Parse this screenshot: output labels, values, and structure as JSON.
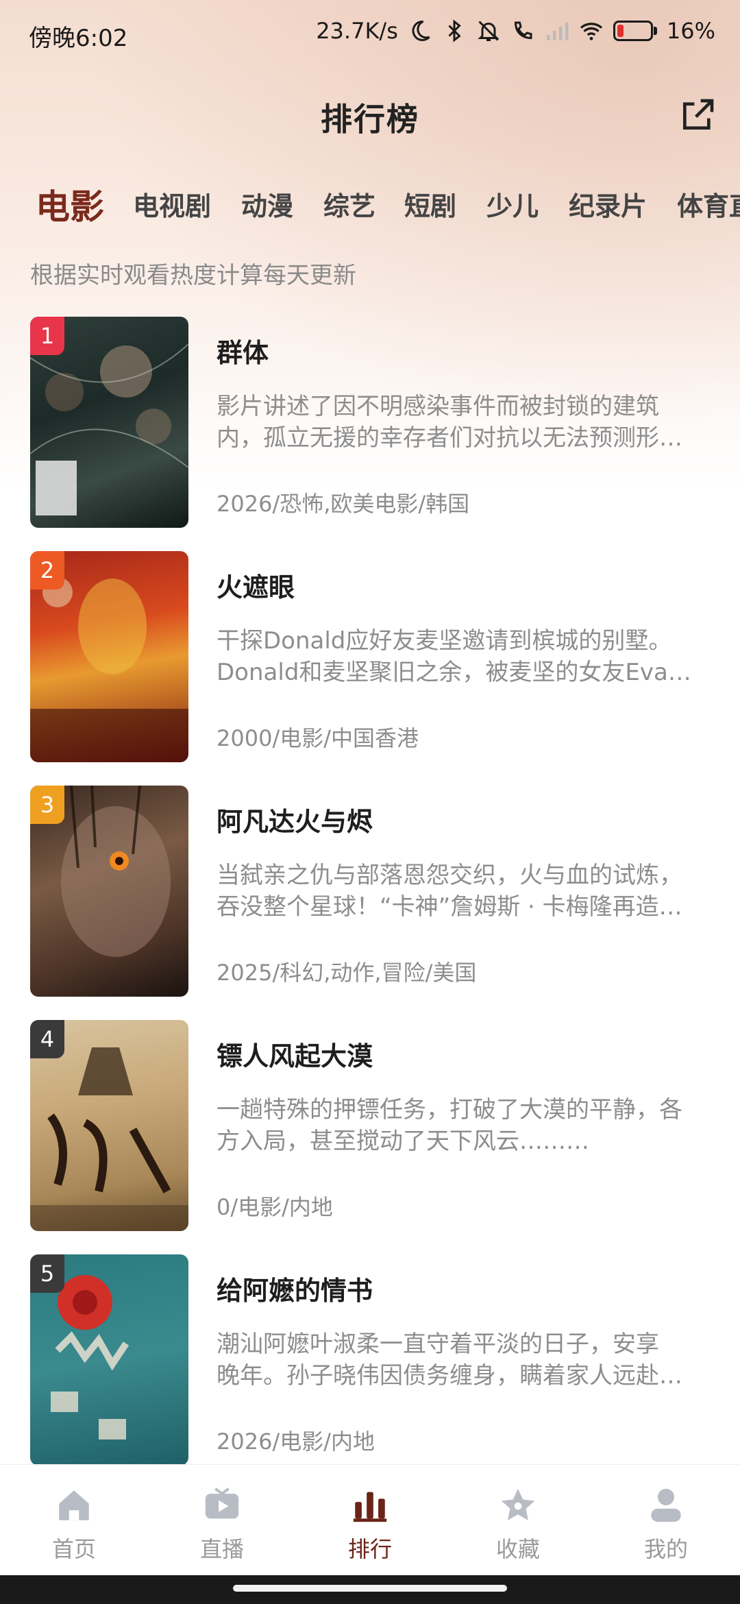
{
  "status_bar": {
    "time": "傍晚6:02",
    "net_speed": "23.7K/s",
    "battery": "16%"
  },
  "header": {
    "title": "排行榜"
  },
  "tabs": [
    {
      "label": "电影",
      "active": true
    },
    {
      "label": "电视剧"
    },
    {
      "label": "动漫"
    },
    {
      "label": "综艺"
    },
    {
      "label": "短剧"
    },
    {
      "label": "少儿"
    },
    {
      "label": "纪录片"
    },
    {
      "label": "体育直"
    }
  ],
  "subtitle": "根据实时观看热度计算每天更新",
  "items": [
    {
      "rank": "1",
      "rank_color": "#e8354a",
      "title": "群体",
      "desc_line1": "影片讲述了因不明感染事件而被封锁的建筑",
      "desc_line2": "内，孤立无援的幸存者们对抗以无法预测形…",
      "meta": "2026/恐怖,欧美电影/韩国"
    },
    {
      "rank": "2",
      "rank_color": "#ee5a24",
      "title": "火遮眼",
      "desc_line1": "干探Donald应好友麦坚邀请到槟城的别墅。",
      "desc_line2": "Donald和麦坚聚旧之余，被麦坚的女友Eva…",
      "meta": "2000/电影/中国香港"
    },
    {
      "rank": "3",
      "rank_color": "#f0a020",
      "title": "阿凡达火与烬",
      "desc_line1": "当弑亲之仇与部落恩怨交织，火与血的试炼，",
      "desc_line2": "吞没整个星球！“卡神”詹姆斯 · 卡梅隆再造…",
      "meta": "2025/科幻,动作,冒险/美国"
    },
    {
      "rank": "4",
      "rank_color": "#3a3a3a",
      "title": "镖人风起大漠",
      "desc_line1": "一趟特殊的押镖任务，打破了大漠的平静，各",
      "desc_line2": "方入局，甚至搅动了天下风云………",
      "meta": "0/电影/内地"
    },
    {
      "rank": "5",
      "rank_color": "#3a3a3a",
      "title": "给阿嬷的情书",
      "desc_line1": "潮汕阿嬷叶淑柔一直守着平淡的日子，安享",
      "desc_line2": "晚年。孙子晓伟因债务缠身，瞒着家人远赴…",
      "meta": "2026/电影/内地"
    }
  ],
  "bottom_nav": [
    {
      "label": "首页",
      "icon": "home-icon"
    },
    {
      "label": "直播",
      "icon": "tv-icon"
    },
    {
      "label": "排行",
      "icon": "ranking-icon",
      "active": true
    },
    {
      "label": "收藏",
      "icon": "star-icon"
    },
    {
      "label": "我的",
      "icon": "user-icon"
    }
  ],
  "colors": {
    "accent": "#7a2a1c",
    "nav_active": "#6b2418",
    "text_muted": "#8d8d8d"
  }
}
